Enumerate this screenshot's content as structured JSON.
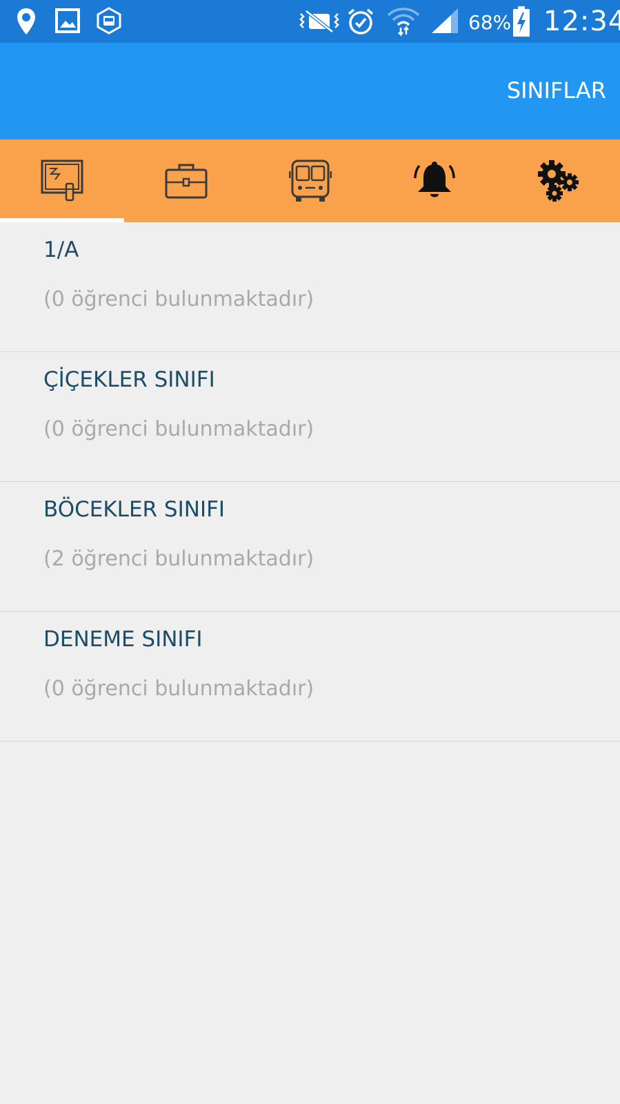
{
  "status_bar": {
    "battery_percent": "68%",
    "time": "12:34"
  },
  "app_bar": {
    "title": "SINIFLAR"
  },
  "tabs": [
    {
      "icon": "classroom-board-icon",
      "active": true
    },
    {
      "icon": "briefcase-icon",
      "active": false
    },
    {
      "icon": "bus-icon",
      "active": false
    },
    {
      "icon": "bell-icon",
      "active": false
    },
    {
      "icon": "gears-icon",
      "active": false
    }
  ],
  "classes": [
    {
      "name": "1/A",
      "count_text": "(0 öğrenci bulunmaktadır)"
    },
    {
      "name": "ÇİÇEKLER SINIFI",
      "count_text": "(0 öğrenci bulunmaktadır)"
    },
    {
      "name": "BÖCEKLER SINIFI",
      "count_text": "(2 öğrenci bulunmaktadır)"
    },
    {
      "name": "DENEME SINIFI",
      "count_text": "(0 öğrenci bulunmaktadır)"
    }
  ],
  "colors": {
    "status_bar": "#1a7ad6",
    "app_bar": "#2196f3",
    "tab_bar": "#f9a24b",
    "class_name": "#1c4c66",
    "class_count": "#a9a9a9",
    "background": "#efefef"
  }
}
